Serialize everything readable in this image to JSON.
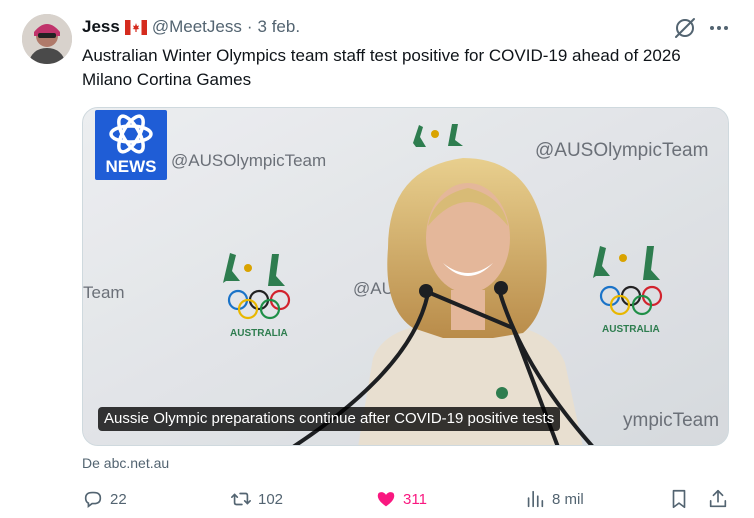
{
  "post": {
    "author_name": "Jess",
    "author_handle": "@MeetJess",
    "separator": "·",
    "date": "3 feb.",
    "text": "Australian Winter Olympics team staff test positive for COVID-19 ahead of 2026 Milano Cortina Games"
  },
  "card": {
    "logo_text": "NEWS",
    "caption": "Aussie Olympic preparations continue after COVID-19 positive tests",
    "backdrop_text": [
      "@AUSOlympicTeam",
      "@AUSOlympicTeam",
      "Team",
      "@AUS",
      "ympicTeam",
      "AUSTRALIA",
      "AUSTRALIA"
    ]
  },
  "source": {
    "label": "De abc.net.au"
  },
  "actions": {
    "replies": "22",
    "reposts": "102",
    "likes": "311",
    "views": "8 mil"
  },
  "colors": {
    "text_primary": "#0f1419",
    "text_secondary": "#536471",
    "like_pink": "#f91880",
    "abc_blue": "#1f5dd6",
    "olympic_green": "#2e7d4f",
    "olympic_gold": "#d9a300"
  },
  "icons": {
    "author_badge": "canada-flag-icon",
    "header_right": [
      "grok-icon",
      "more-icon"
    ],
    "actions": [
      "reply-icon",
      "repost-icon",
      "like-icon",
      "views-icon",
      "bookmark-icon",
      "share-icon"
    ]
  }
}
